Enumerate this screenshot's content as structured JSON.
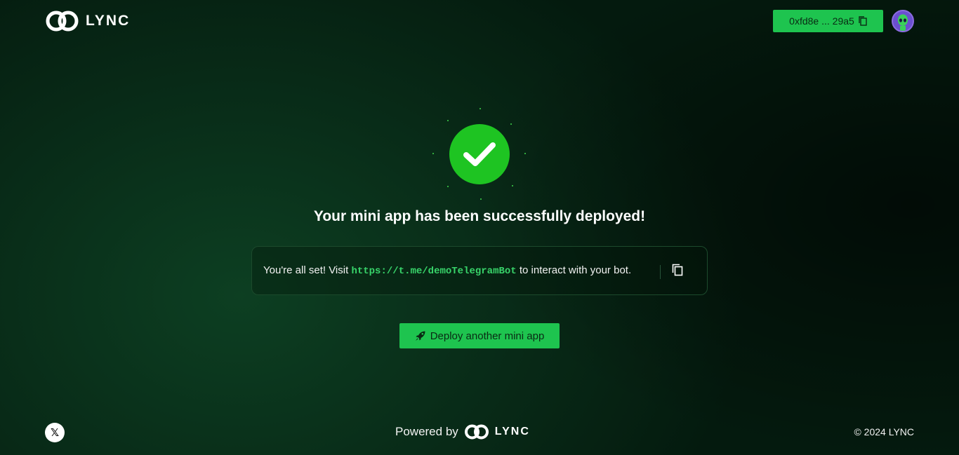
{
  "brand": {
    "name": "LYNC"
  },
  "header": {
    "wallet_address": "0xfd8e ... 29a5",
    "copy_icon": "copy-icon",
    "avatar_icon": "avatar"
  },
  "success": {
    "icon": "check-icon",
    "title": "Your mini app has been successfully deployed!",
    "message_prefix": "You're all set! Visit",
    "bot_url": "https://t.me/demoTelegramBot",
    "message_suffix": "to interact with your bot."
  },
  "actions": {
    "deploy_another_label": "Deploy another mini app",
    "deploy_icon": "rocket-icon"
  },
  "footer": {
    "powered_by": "Powered by",
    "powered_brand": "LYNC",
    "copyright": "© 2024 LYNC",
    "social_icon": "x-icon"
  },
  "colors": {
    "accent": "#1ec44f",
    "link": "#38d46a",
    "check": "#1ec422"
  }
}
